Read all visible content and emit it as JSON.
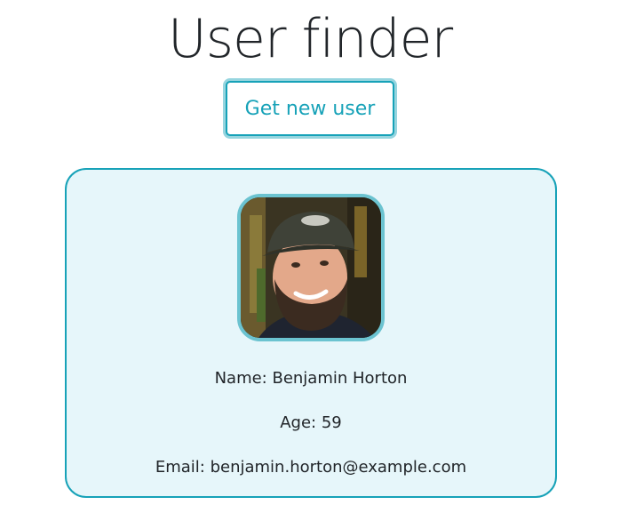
{
  "header": {
    "title": "User finder",
    "new_user_label": "Get new user"
  },
  "user": {
    "avatar_icon": "user-photo",
    "name_line": "Name: Benjamin Horton",
    "age_line": "Age: 59",
    "email_line": "Email: benjamin.horton@example.com"
  },
  "colors": {
    "accent": "#17a2b8",
    "card_background": "#e6f6fa",
    "avatar_border": "#6bc3d0"
  }
}
